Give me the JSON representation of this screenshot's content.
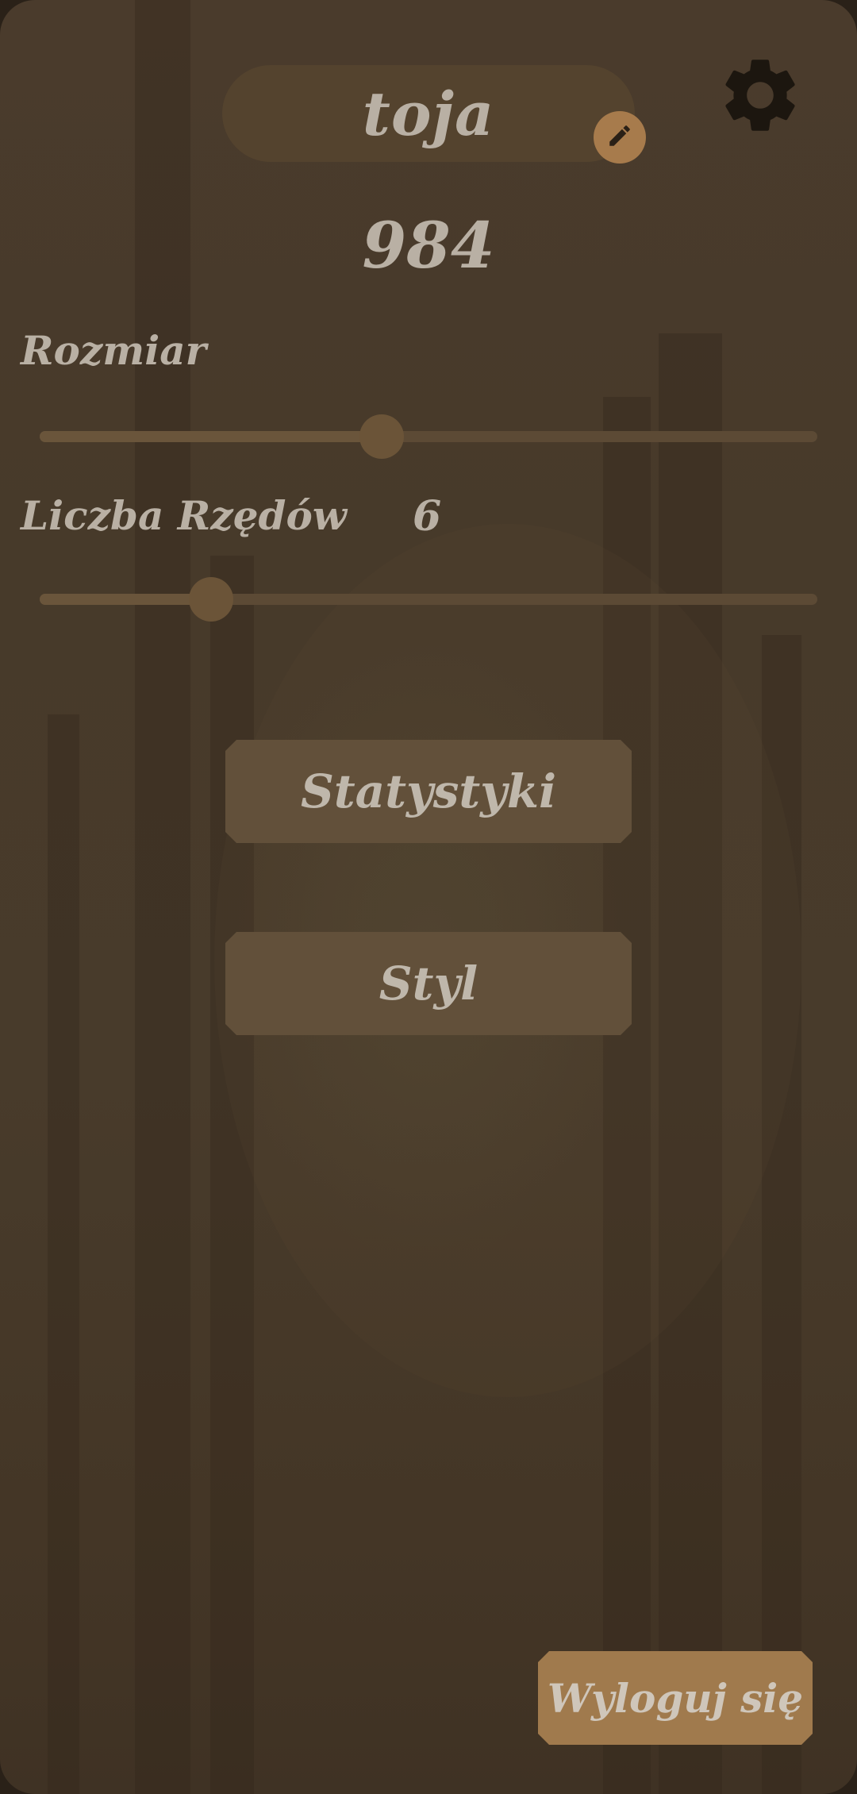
{
  "profile": {
    "name": "toja",
    "score": "984"
  },
  "icons": {
    "edit": "pencil-icon",
    "settings": "gear-icon"
  },
  "settings": {
    "size_label": "Rozmiar",
    "size_value_fraction": 0.44,
    "rows_label": "Liczba Rzędów",
    "rows_value": "6",
    "rows_value_fraction": 0.22
  },
  "menu": {
    "stats_label": "Statystyki",
    "style_label": "Styl"
  },
  "account": {
    "logout_label": "Wyloguj się"
  },
  "colors": {
    "background": "#483b2b",
    "accent": "#a77b4c",
    "button": "#62503a",
    "text": "#b9b0a4"
  }
}
